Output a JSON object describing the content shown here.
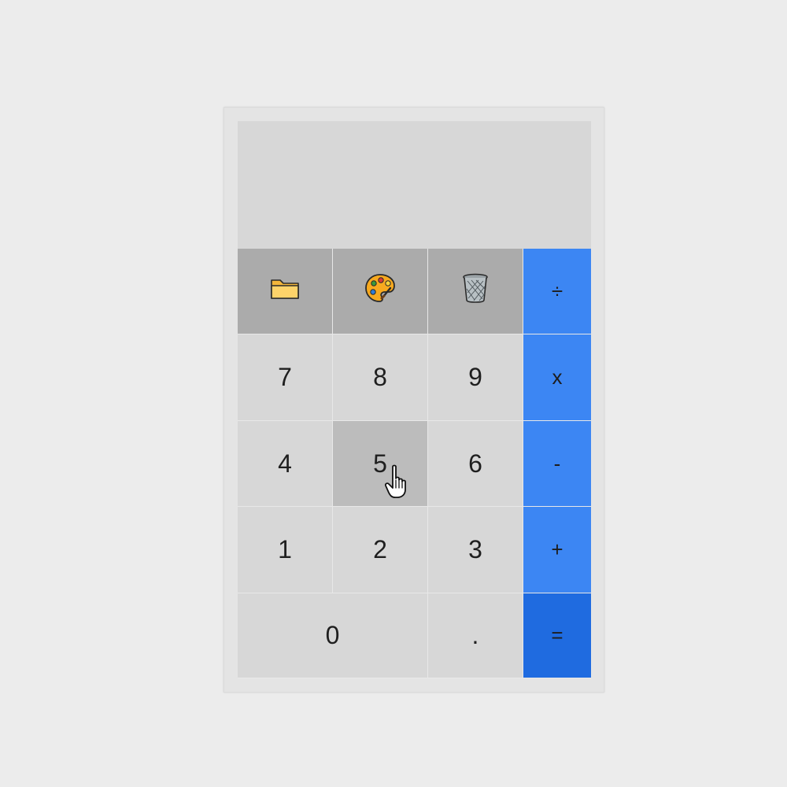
{
  "display": {
    "value": ""
  },
  "function_keys": [
    {
      "name": "open-file",
      "icon": "folder-icon"
    },
    {
      "name": "theme",
      "icon": "palette-icon"
    },
    {
      "name": "clear",
      "icon": "trash-icon"
    }
  ],
  "operators": {
    "divide": "÷",
    "multiply": "x",
    "subtract": "-",
    "add": "+",
    "equals": "="
  },
  "digits": {
    "d7": "7",
    "d8": "8",
    "d9": "9",
    "d4": "4",
    "d5": "5",
    "d6": "6",
    "d1": "1",
    "d2": "2",
    "d3": "3",
    "d0": "0",
    "decimal": "."
  },
  "state": {
    "pressed_key": "5"
  },
  "colors": {
    "background": "#ececec",
    "panel": "#e4e4e4",
    "display": "#d7d7d7",
    "digit_key": "#d7d7d7",
    "function_key": "#ababab",
    "pressed_key": "#bcbcbc",
    "operator_key": "#3c86f3",
    "equals_key": "#1f6be0"
  }
}
